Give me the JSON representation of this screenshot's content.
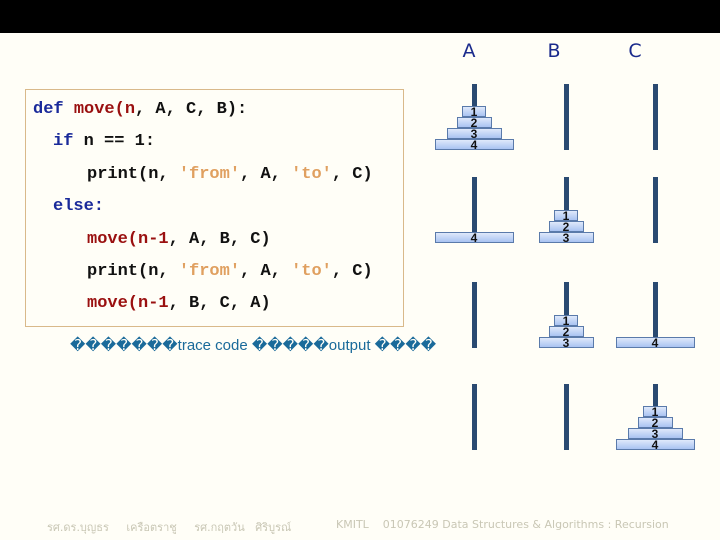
{
  "header": {
    "peg_labels": [
      "A",
      "B",
      "C"
    ]
  },
  "code": {
    "lines": [
      {
        "parts": [
          {
            "t": "def ",
            "c": "kw"
          },
          {
            "t": "move(n",
            "c": "fn"
          },
          {
            "t": ", A, C, B):",
            "c": ""
          }
        ]
      },
      {
        "parts": [
          {
            "t": "if ",
            "c": "kw"
          },
          {
            "t": "n == 1:",
            "c": ""
          }
        ]
      },
      {
        "parts": [
          {
            "t": "print(n, ",
            "c": ""
          },
          {
            "t": "'from'",
            "c": "str"
          },
          {
            "t": ", A, ",
            "c": ""
          },
          {
            "t": "'to'",
            "c": "str"
          },
          {
            "t": ", C)",
            "c": ""
          }
        ]
      },
      {
        "parts": [
          {
            "t": "else:",
            "c": "kw"
          }
        ]
      },
      {
        "parts": [
          {
            "t": "move(n-1",
            "c": "fn"
          },
          {
            "t": ", A, B, C)",
            "c": ""
          }
        ]
      },
      {
        "parts": [
          {
            "t": "print(n, ",
            "c": ""
          },
          {
            "t": "'from'",
            "c": "str"
          },
          {
            "t": ", A, ",
            "c": ""
          },
          {
            "t": "'to'",
            "c": "str"
          },
          {
            "t": ", C)",
            "c": ""
          }
        ]
      },
      {
        "parts": [
          {
            "t": "move(n-1",
            "c": "fn"
          },
          {
            "t": ", B, C, A)",
            "c": ""
          }
        ]
      }
    ]
  },
  "caption": "�������trace code �����output ����",
  "hanoi": {
    "pegs": [
      "A",
      "B",
      "C"
    ],
    "stages": [
      {
        "A": [
          4,
          3,
          2,
          1
        ],
        "B": [],
        "C": []
      },
      {
        "A": [
          4
        ],
        "B": [
          3,
          2,
          1
        ],
        "C": []
      },
      {
        "A": [],
        "B": [
          3,
          2,
          1
        ],
        "C": [
          4
        ]
      },
      {
        "A": [],
        "B": [],
        "C": [
          4,
          3,
          2,
          1
        ]
      }
    ]
  },
  "footer": {
    "authors": "รศ.ดร.บุญธร     เครือตราชู     รศ.กฤตวัน   ศิริบูรณ์",
    "course": "KMITL    01076249 Data Structures & Algorithms : Recursion"
  }
}
